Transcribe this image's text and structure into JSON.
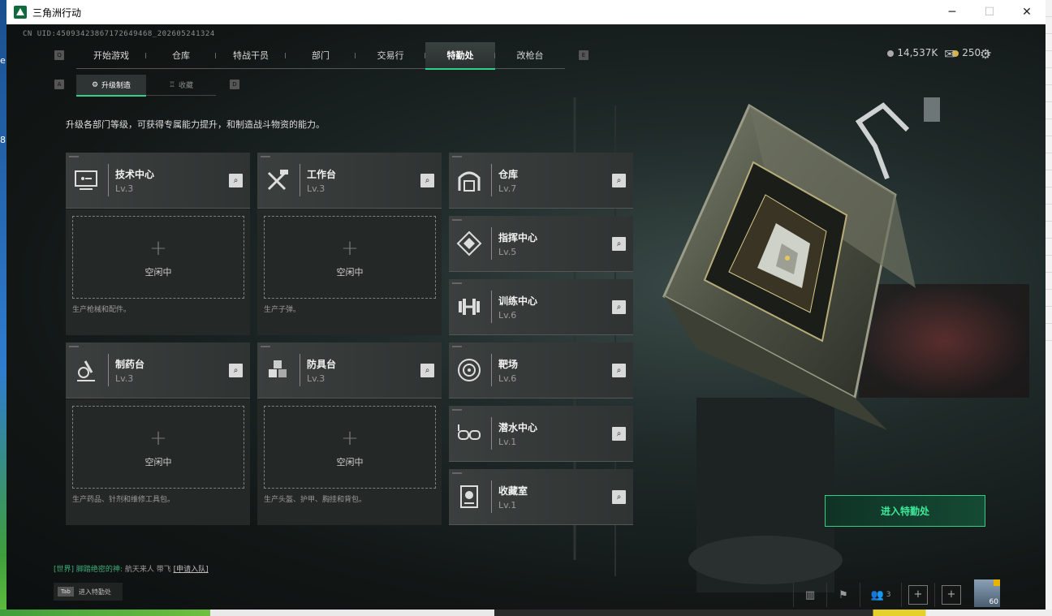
{
  "window": {
    "title": "三角洲行动",
    "min_icon": "minimize-icon",
    "max_icon": "maximize-icon",
    "close_icon": "close-icon"
  },
  "uid": "CN UID:450934238671726494​68_20260524132​4",
  "tabs": [
    {
      "label": "开始游戏"
    },
    {
      "label": "仓库"
    },
    {
      "label": "特战干员"
    },
    {
      "label": "部门"
    },
    {
      "label": "交易行"
    },
    {
      "label": "特勤处",
      "active": true
    },
    {
      "label": "改枪台"
    }
  ],
  "keys": {
    "left": "Q",
    "right": "E",
    "sub_left": "A",
    "sub_right": "D"
  },
  "subtabs": [
    {
      "label": "升级制造",
      "active": true
    },
    {
      "label": "收藏"
    }
  ],
  "currency": {
    "money": "14,537K",
    "coins": "250",
    "add": "+"
  },
  "description": "升级各部门等级，可获得专属能力提升，和制造战斗物资的能力。",
  "big_cards": [
    {
      "name": "技术中心",
      "level": "Lv.3",
      "slot_status": "空闲中",
      "slot_desc": "生产枪械和配件。",
      "icon": "monitor-icon"
    },
    {
      "name": "工作台",
      "level": "Lv.3",
      "slot_status": "空闲中",
      "slot_desc": "生产子弹。",
      "icon": "tools-icon"
    },
    {
      "name": "制药台",
      "level": "Lv.3",
      "slot_status": "空闲中",
      "slot_desc": "生产药品、针剂和维修工具包。",
      "icon": "microscope-icon"
    },
    {
      "name": "防具台",
      "level": "Lv.3",
      "slot_status": "空闲中",
      "slot_desc": "生产头盔、护甲、胸挂和背包。",
      "icon": "cubes-icon"
    }
  ],
  "side_cards": [
    {
      "name": "仓库",
      "level": "Lv.7",
      "icon": "warehouse-icon"
    },
    {
      "name": "指挥中心",
      "level": "Lv.5",
      "icon": "command-icon"
    },
    {
      "name": "训练中心",
      "level": "Lv.6",
      "icon": "dumbbell-icon"
    },
    {
      "name": "靶场",
      "level": "Lv.6",
      "icon": "target-icon"
    },
    {
      "name": "潜水中心",
      "level": "Lv.1",
      "icon": "diving-mask-icon"
    },
    {
      "name": "收藏室",
      "level": "Lv.1",
      "icon": "trophy-icon"
    }
  ],
  "enter_button": "进入特勤处",
  "chat": {
    "channel": "[世界]",
    "sender": "脚踏绝密的神:",
    "message": "航天来人 带飞",
    "link": "[申请入队]"
  },
  "tab_hint": {
    "key": "Tab",
    "label": "进入特勤处"
  },
  "bottom_bar": {
    "friends": "3",
    "level": "60"
  },
  "colors": {
    "accent": "#2fd08a",
    "card_bg": "#3b3f3e"
  }
}
